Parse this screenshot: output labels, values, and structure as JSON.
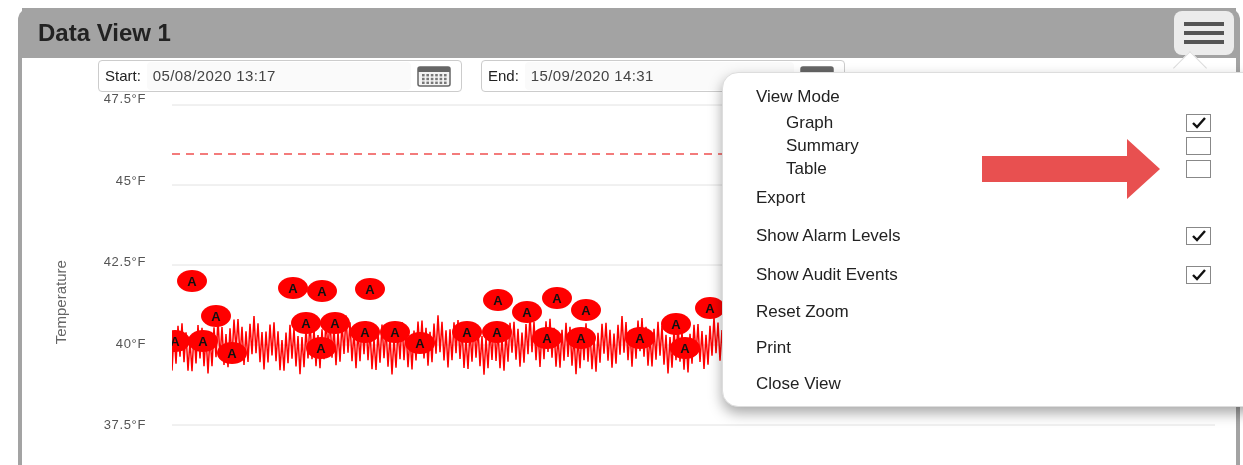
{
  "panel": {
    "title": "Data View 1"
  },
  "date_range": [
    {
      "label": "Start:",
      "value": "05/08/2020 13:17"
    },
    {
      "label": "End:",
      "value": "15/09/2020 14:31"
    }
  ],
  "chart": {
    "ylabel": "Temperature",
    "yticks": [
      "47.5°F",
      "45°F",
      "42.5°F",
      "40°F",
      "37.5°F"
    ],
    "audit_markers": [
      "A",
      "A",
      "A",
      "A",
      "A",
      "A",
      "A",
      "A",
      "A",
      "A",
      "A",
      "A",
      "A",
      "A",
      "A",
      "A",
      "A",
      "A",
      "A",
      "A",
      "A",
      "A",
      "A",
      "A",
      "A",
      "A"
    ]
  },
  "menu": {
    "items": [
      {
        "kind": "heading",
        "label": "View Mode"
      },
      {
        "kind": "option",
        "label": "Graph",
        "checked": true
      },
      {
        "kind": "option",
        "label": "Summary",
        "checked": false
      },
      {
        "kind": "option",
        "label": "Table",
        "checked": false
      },
      {
        "kind": "action",
        "label": "Export"
      },
      {
        "kind": "toggle",
        "label": "Show Alarm Levels",
        "checked": true
      },
      {
        "kind": "toggle",
        "label": "Show Audit Events",
        "checked": true
      },
      {
        "kind": "action",
        "label": "Reset Zoom"
      },
      {
        "kind": "action",
        "label": "Print"
      },
      {
        "kind": "action",
        "label": "Close View"
      }
    ]
  }
}
